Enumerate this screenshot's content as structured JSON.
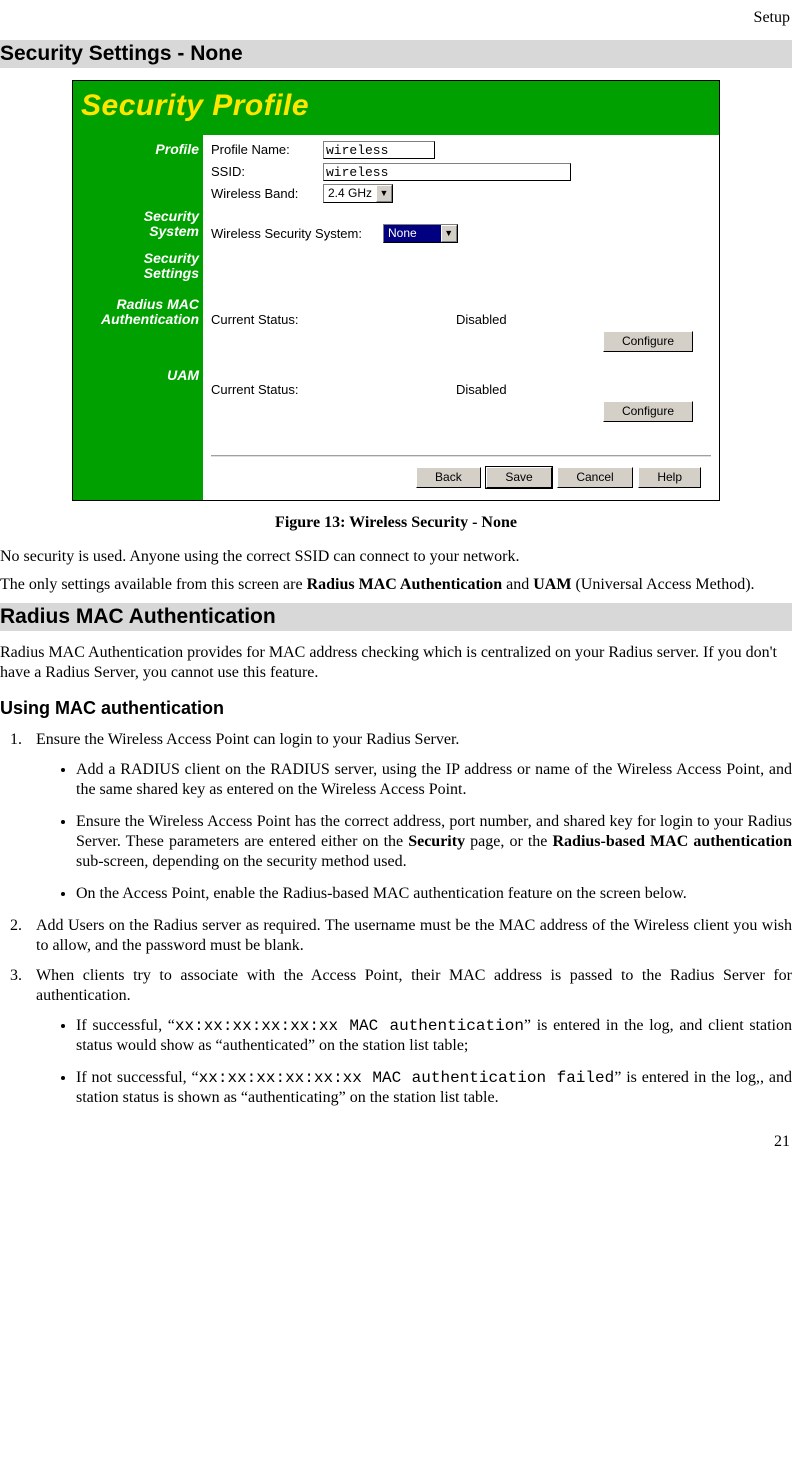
{
  "header": {
    "section": "Setup"
  },
  "headings": {
    "h2_1": "Security Settings - None",
    "h2_2": "Radius MAC Authentication",
    "h3_1": "Using MAC authentication"
  },
  "figure": {
    "title": "Security Profile",
    "sidebar": {
      "profile": "Profile",
      "security_system": "Security System",
      "security_settings": "Security Settings",
      "radius_mac": "Radius MAC Authentication",
      "uam": "UAM"
    },
    "profile": {
      "name_label": "Profile Name:",
      "name_value": "wireless",
      "ssid_label": "SSID:",
      "ssid_value": "wireless",
      "band_label": "Wireless Band:",
      "band_value": "2.4 GHz"
    },
    "security_system": {
      "label": "Wireless Security System:",
      "value": "None"
    },
    "radius_mac": {
      "status_label": "Current Status:",
      "status_value": "Disabled",
      "configure": "Configure"
    },
    "uam": {
      "status_label": "Current Status:",
      "status_value": "Disabled",
      "configure": "Configure"
    },
    "buttons": {
      "back": "Back",
      "save": "Save",
      "cancel": "Cancel",
      "help": "Help"
    },
    "caption": "Figure 13: Wireless Security - None"
  },
  "body": {
    "p1": "No security is used. Anyone using the correct SSID can connect to your network.",
    "p2a": "The only settings available from this screen are ",
    "p2b": "Radius MAC Authentication",
    "p2c": " and ",
    "p2d": "UAM",
    "p2e": " (Universal Access Method).",
    "p3": "Radius MAC Authentication provides for MAC address checking which is centralized on your Radius server. If you don't have a Radius Server, you cannot use this feature."
  },
  "steps": {
    "s1": "Ensure the Wireless Access Point can login to your Radius Server.",
    "s1a": "Add a RADIUS client on the RADIUS server, using the IP address or name of the Wireless Access Point, and the same shared key as entered on the Wireless Access Point.",
    "s1b_a": "Ensure the Wireless Access Point has the correct address, port number, and shared key for login to your Radius Server. These parameters are entered either on the ",
    "s1b_b": "Security",
    "s1b_c": " page, or the ",
    "s1b_d": "Radius-based MAC authentication",
    "s1b_e": " sub-screen, depending on the security method used.",
    "s1c": "On the Access Point, enable the Radius-based MAC authentication feature on the screen below.",
    "s2": "Add Users on the Radius server as required. The username must be the MAC address of the Wireless client you wish to allow, and the password must be blank.",
    "s3": "When clients try to associate with the Access Point, their MAC address is passed to the Radius Server for authentication.",
    "s3a_a": "If successful, “",
    "s3a_b": "xx:xx:xx:xx:xx:xx MAC authentication",
    "s3a_c": "” is entered in the log, and client station status would show as “authenticated” on the station list table;",
    "s3b_a": "If not successful,  “",
    "s3b_b": "xx:xx:xx:xx:xx:xx MAC authentication failed",
    "s3b_c": "” is en­tered in the log,, and station status is shown as “authenticating” on the station list table."
  },
  "page_number": "21"
}
